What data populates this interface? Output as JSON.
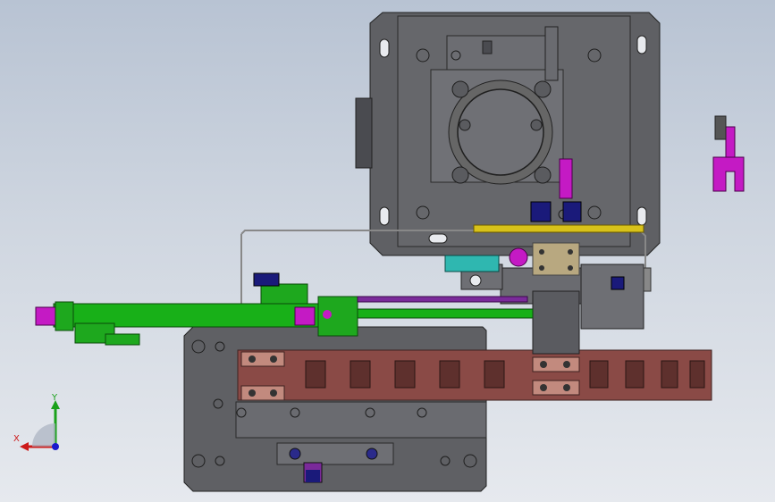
{
  "app": {
    "view": "cad-3d-viewport"
  },
  "triad": {
    "x_label": "X",
    "y_label": "Y",
    "x_color": "#cc1a1a",
    "y_color": "#1aa11a",
    "z_color": "#1a1acc"
  },
  "colors": {
    "steel": "#5f6064",
    "steel_dark": "#3b3c40",
    "steel_light": "#7a7b80",
    "cylinder_green": "#18b018",
    "cylinder_magenta": "#c41ac4",
    "chain_red": "#8a4a46",
    "chain_dark": "#5e302d",
    "teal": "#2fb7b0",
    "yellow": "#d8c21a",
    "navy": "#1a1a7a",
    "tan": "#b8a880"
  }
}
